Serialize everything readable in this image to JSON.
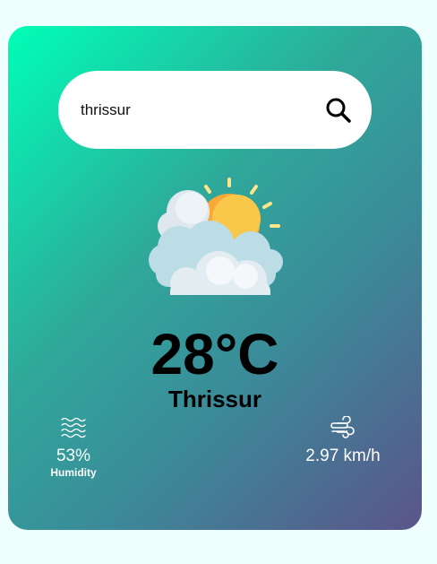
{
  "search": {
    "value": "thrissur",
    "icon": "search-icon"
  },
  "weather": {
    "icon": "sun-behind-clouds-icon",
    "temperature": "28°C",
    "city": "Thrissur"
  },
  "humidity": {
    "icon": "humidity-waves-icon",
    "value": "53%",
    "label": "Humidity"
  },
  "wind": {
    "icon": "wind-icon",
    "value": "2.97 km/h"
  },
  "colors": {
    "background": "#effffd",
    "gradient_start": "#00ffb7",
    "gradient_end": "#5b548a",
    "sun": "#fbb934"
  }
}
